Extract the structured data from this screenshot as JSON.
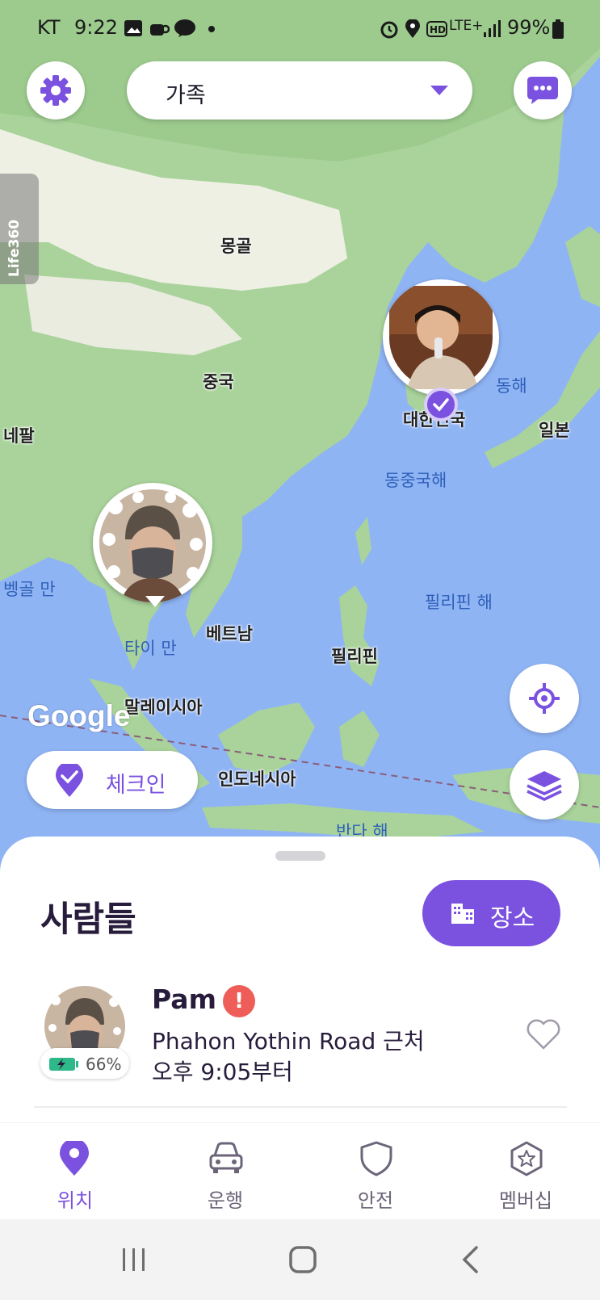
{
  "status_bar": {
    "carrier": "KT",
    "time": "9:22",
    "network": "LTE+",
    "battery": "99%"
  },
  "top_bar": {
    "circle_name": "가족",
    "brand_tab": "Life360"
  },
  "map": {
    "attribution": "Google",
    "land_labels": {
      "mongolia": "몽골",
      "china": "중국",
      "nepal": "네팔",
      "korea": "대한민국",
      "japan": "일본",
      "vietnam": "베트남",
      "philippines": "필리핀",
      "malaysia": "말레이시아",
      "indonesia": "인도네시아"
    },
    "water_labels": {
      "east_sea": "동해",
      "east_china_sea": "동중국해",
      "bay_of_bengal": "벵골 만",
      "gulf_of_thailand": "타이 만",
      "philippine_sea": "필리핀 해",
      "banda_sea": "반다 해"
    }
  },
  "actions": {
    "checkin_label": "체크인"
  },
  "sheet": {
    "title": "사람들",
    "places_label": "장소",
    "member": {
      "name": "Pam",
      "alert": "!",
      "battery": "66%",
      "address": "Phahon Yothin Road 근처",
      "since": "오후 9:05부터"
    }
  },
  "tabs": [
    {
      "label": "위치",
      "icon": "location-pin-icon",
      "active": true
    },
    {
      "label": "운행",
      "icon": "car-icon",
      "active": false
    },
    {
      "label": "안전",
      "icon": "shield-icon",
      "active": false
    },
    {
      "label": "멤버십",
      "icon": "membership-star-icon",
      "active": false
    }
  ],
  "colors": {
    "accent": "#7b52e0",
    "alert": "#ee5d57",
    "water": "#8fb4f4",
    "land": "#a9d39b"
  }
}
